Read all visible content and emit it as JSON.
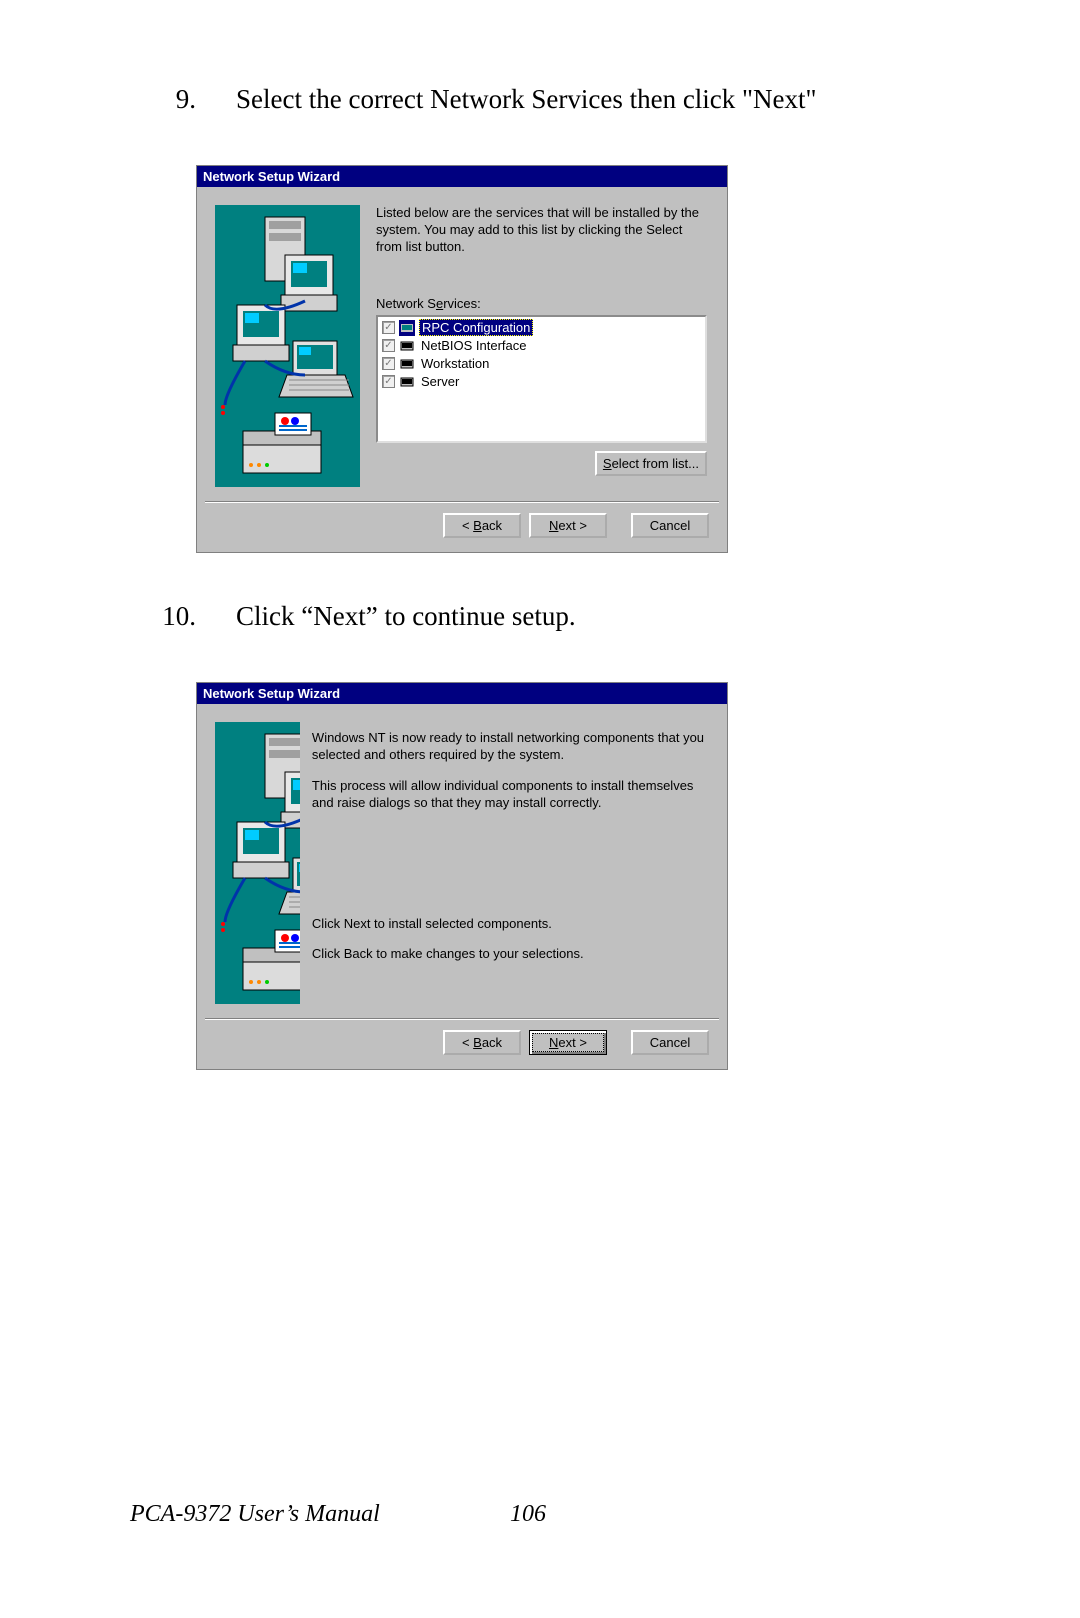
{
  "step1": {
    "num": "9.",
    "text": "Select the correct Network Services then click \"Next\""
  },
  "step2": {
    "num": "10.",
    "text": "Click “Next” to continue setup."
  },
  "dialog1": {
    "title": "Network Setup Wizard",
    "intro": "Listed below are the services that will be installed by the system. You may add to this list by clicking the Select from list button.",
    "list_label_pre": "Network S",
    "list_label_ul": "e",
    "list_label_post": "rvices:",
    "services": [
      {
        "label": "RPC Configuration",
        "selected": true
      },
      {
        "label": "NetBIOS Interface",
        "selected": false
      },
      {
        "label": "Workstation",
        "selected": false
      },
      {
        "label": "Server",
        "selected": false
      }
    ],
    "select_button_ul": "S",
    "select_button_post": "elect from list...",
    "back_lt": "< ",
    "back_ul": "B",
    "back_post": "ack",
    "next_ul": "N",
    "next_post": "ext >",
    "cancel": "Cancel"
  },
  "dialog2": {
    "title": "Network Setup Wizard",
    "para1": "Windows NT is now ready to install networking components that you selected and others required by the system.",
    "para2": "This process will allow individual components to install themselves and raise dialogs so that they may install correctly.",
    "para3": "Click Next to install selected components.",
    "para4": "Click Back to make changes to your selections.",
    "back_lt": "< ",
    "back_ul": "B",
    "back_post": "ack",
    "next_ul": "N",
    "next_post": "ext >",
    "cancel": "Cancel"
  },
  "footer": {
    "manual": "PCA-9372 User’s Manual",
    "page": "106"
  }
}
